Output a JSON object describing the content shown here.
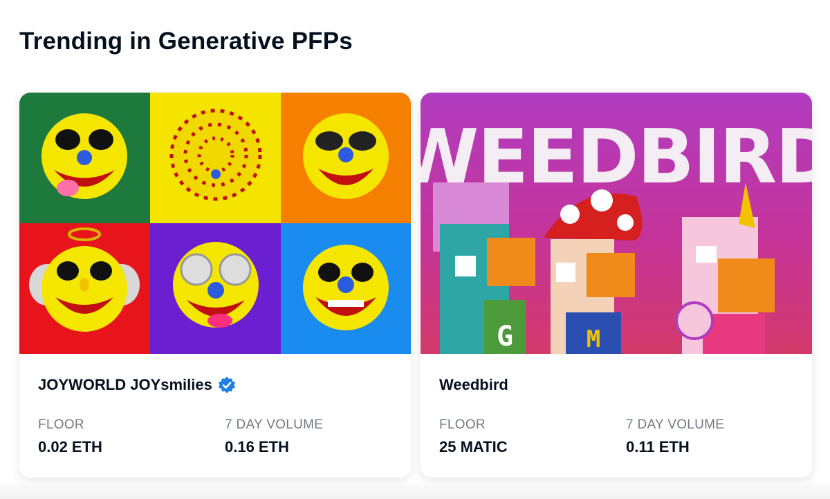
{
  "section": {
    "title": "Trending in Generative PFPs"
  },
  "cards": [
    {
      "name": "JOYWORLD JOYsmilies",
      "verified": true,
      "floor_label": "FLOOR",
      "floor_value": "0.02 ETH",
      "volume_label": "7 DAY VOLUME",
      "volume_value": "0.16 ETH",
      "banner_tiles": [
        "#1e7a3c",
        "#f4e400",
        "#f57f00",
        "#e8141c",
        "#6a1fd0",
        "#1a8cf0"
      ]
    },
    {
      "name": "Weedbird",
      "banner_text": "WEEDBIRD",
      "floor_label": "FLOOR",
      "floor_value": "25 MATIC",
      "volume_label": "7 DAY VOLUME",
      "volume_value": "0.11 ETH"
    }
  ],
  "colors": {
    "verified": "#2081e2",
    "label": "#707a83",
    "text": "#04111d"
  }
}
